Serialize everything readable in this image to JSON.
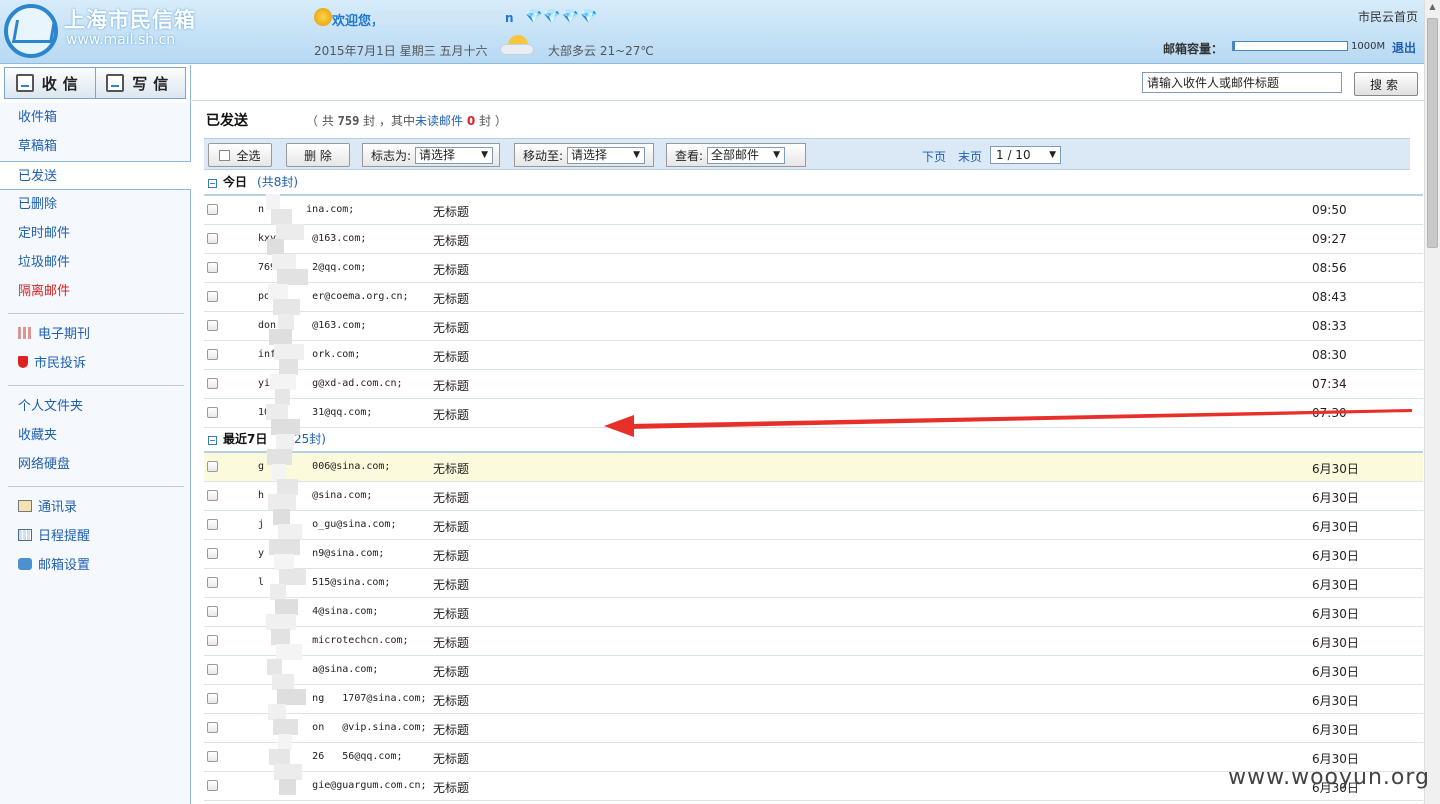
{
  "header": {
    "logo_text": "上海市民信箱",
    "logo_url": "www.mail.sh.cn",
    "greeting": "欢迎您，",
    "user_tail": "n",
    "diamonds": "💎💎💎💎",
    "date_info": "2015年7月1日  星期三  五月十六",
    "weather": "大部多云  21~27℃",
    "home_link": "市民云首页",
    "quota_label": "邮箱容量：",
    "quota_max": "1000M",
    "quota_used_fraction": 0.02,
    "logout": "退出"
  },
  "sidebar": {
    "inbox_btn": "收信",
    "compose_btn": "写信",
    "groups": [
      [
        {
          "label": "收件箱",
          "name": "sidebar-item-inbox"
        },
        {
          "label": "草稿箱",
          "name": "sidebar-item-drafts"
        },
        {
          "label": "已发送",
          "name": "sidebar-item-sent",
          "active": true
        },
        {
          "label": "已删除",
          "name": "sidebar-item-deleted"
        },
        {
          "label": "定时邮件",
          "name": "sidebar-item-scheduled"
        },
        {
          "label": "垃圾邮件",
          "name": "sidebar-item-spam"
        },
        {
          "label": "隔离邮件",
          "name": "sidebar-item-quarantine",
          "red": true
        }
      ],
      [
        {
          "label": "电子期刊",
          "name": "sidebar-item-ejournal",
          "icon": "grid-icon"
        },
        {
          "label": "市民投诉",
          "name": "sidebar-item-complaint",
          "icon": "shield-icon"
        }
      ],
      [
        {
          "label": "个人文件夹",
          "name": "sidebar-item-personal-folder"
        },
        {
          "label": "收藏夹",
          "name": "sidebar-item-favorites"
        },
        {
          "label": "网络硬盘",
          "name": "sidebar-item-netdisk"
        }
      ],
      [
        {
          "label": "通讯录",
          "name": "sidebar-item-contacts",
          "icon": "contacts-icon"
        },
        {
          "label": "日程提醒",
          "name": "sidebar-item-calendar",
          "icon": "calendar-icon"
        },
        {
          "label": "邮箱设置",
          "name": "sidebar-item-settings",
          "icon": "settings-icon"
        }
      ]
    ]
  },
  "search": {
    "value": "请输入收件人或邮件标题",
    "button": "搜索"
  },
  "folder": {
    "title": "已发送",
    "summary_prefix": "（ 共",
    "total": "759",
    "summary_mid": "封 ，其中",
    "unread_label": "未读邮件",
    "unread_count": "0",
    "summary_suffix": "封 ）"
  },
  "toolbar": {
    "select_all": "全选",
    "delete": "删 除",
    "mark_label": "标志为:",
    "mark_value": "请选择",
    "move_label": "移动至:",
    "move_value": "请选择",
    "view_label": "查看:",
    "view_value": "全部邮件",
    "next_page": "下页",
    "last_page": "末页",
    "page_value": "1 / 10"
  },
  "groups": [
    {
      "title": "今日",
      "count": "(共8封)",
      "rows": [
        {
          "to": "n       ina.com;",
          "subject": "无标题",
          "time": "09:50"
        },
        {
          "to": "kxy      @163.com;",
          "subject": "无标题",
          "time": "09:27"
        },
        {
          "to": "769      2@qq.com;",
          "subject": "无标题",
          "time": "08:56"
        },
        {
          "to": "pos      er@coema.org.cn;",
          "subject": "无标题",
          "time": "08:43"
        },
        {
          "to": "don      @163.com;",
          "subject": "无标题",
          "time": "08:33"
        },
        {
          "to": "inf      ork.com;",
          "subject": "无标题",
          "time": "08:30"
        },
        {
          "to": "yi       g@xd-ad.com.cn;",
          "subject": "无标题",
          "time": "07:34"
        },
        {
          "to": "10       31@qq.com;",
          "subject": "无标题",
          "time": "07:30"
        }
      ]
    },
    {
      "title": "最近7日",
      "count": "(共25封)",
      "rows": [
        {
          "to": "g        006@sina.com;",
          "subject": "无标题",
          "time": "6月30日",
          "highlight": true
        },
        {
          "to": "h        @sina.com;",
          "subject": "无标题",
          "time": "6月30日"
        },
        {
          "to": "j        o_gu@sina.com;",
          "subject": "无标题",
          "time": "6月30日"
        },
        {
          "to": "y        n9@sina.com;",
          "subject": "无标题",
          "time": "6月30日"
        },
        {
          "to": "l        515@sina.com;",
          "subject": "无标题",
          "time": "6月30日"
        },
        {
          "to": "         4@sina.com;",
          "subject": "无标题",
          "time": "6月30日"
        },
        {
          "to": "         microtechcn.com;",
          "subject": "无标题",
          "time": "6月30日"
        },
        {
          "to": "         a@sina.com;",
          "subject": "无标题",
          "time": "6月30日"
        },
        {
          "to": "         ng   1707@sina.com;",
          "subject": "无标题",
          "time": "6月30日"
        },
        {
          "to": "         on   @vip.sina.com;",
          "subject": "无标题",
          "time": "6月30日"
        },
        {
          "to": "         26   56@qq.com;",
          "subject": "无标题",
          "time": "6月30日"
        },
        {
          "to": "         gie@guargum.com.cn;",
          "subject": "无标题",
          "time": "6月30日"
        }
      ]
    }
  ],
  "watermark": "www.wooyun.org",
  "colors": {
    "link": "#1f5fb0",
    "accent": "#2b86cf",
    "alert": "#dd2222",
    "arrow": "#e8302a"
  }
}
